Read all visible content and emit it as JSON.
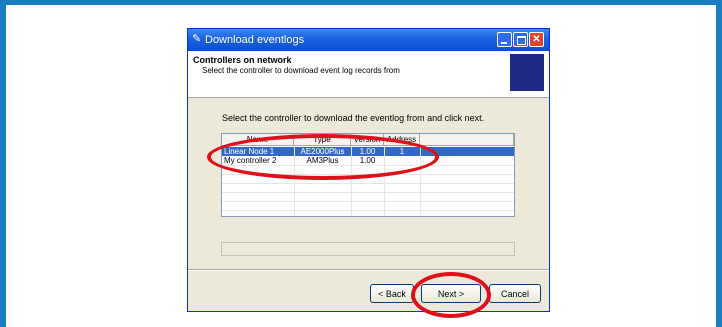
{
  "window": {
    "title": "Download eventlogs"
  },
  "header": {
    "title": "Controllers on network",
    "subtitle": "Select the controller to download event log records from"
  },
  "instruction": "Select the controller to download the eventlog from and click next.",
  "table": {
    "columns": [
      "Name",
      "Type",
      "Version",
      "Address"
    ],
    "rows": [
      {
        "name": "Linear Node 1",
        "type": "AE2000Plus",
        "version": "1.00",
        "address": "1",
        "selected": true
      },
      {
        "name": "My controller 2",
        "type": "AM3Plus",
        "version": "1.00",
        "address": "",
        "selected": false
      }
    ]
  },
  "buttons": {
    "back": "< Back",
    "next": "Next >",
    "cancel": "Cancel"
  },
  "colors": {
    "selection": "#316ac5",
    "annotation": "#e0101a",
    "titlebar": "#0a4fd2",
    "border": "#1a7fc1"
  },
  "icons": {
    "window": "app-icon",
    "minimize": "minimize-icon",
    "maximize": "maximize-icon",
    "close": "close-icon"
  }
}
